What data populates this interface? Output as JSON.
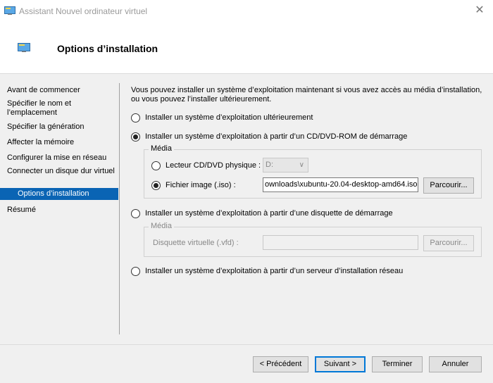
{
  "window": {
    "title": "Assistant Nouvel ordinateur virtuel",
    "close_glyph": "✕",
    "icon": "monitor-icon"
  },
  "header": {
    "title": "Options d’installation",
    "icon": "monitor-icon"
  },
  "sidebar": {
    "items": [
      {
        "label": "Avant de commencer"
      },
      {
        "label": "Spécifier le nom et l’emplacement"
      },
      {
        "label": "Spécifier la génération"
      },
      {
        "label": "Affecter la mémoire"
      },
      {
        "label": "Configurer la mise en réseau"
      },
      {
        "label": "Connecter un disque dur virtuel"
      },
      {
        "label": "Options d’installation"
      },
      {
        "label": "Résumé"
      }
    ],
    "active_index": 6
  },
  "content": {
    "intro": "Vous pouvez installer un système d’exploitation maintenant si vous avez accès au média d’installation, ou vous pouvez l’installer ultérieurement.",
    "options": [
      {
        "label": "Installer un système d’exploitation ultérieurement",
        "checked": false
      },
      {
        "label": "Installer un système d’exploitation à partir d’un CD/DVD-ROM de démarrage",
        "checked": true
      },
      {
        "label": "Installer un système d’exploitation à partir d’une disquette de démarrage",
        "checked": false
      },
      {
        "label": "Installer un système d’exploitation à partir d’un serveur d’installation réseau",
        "checked": false
      }
    ],
    "cd_media": {
      "legend": "Média",
      "physical_label": "Lecteur CD/DVD physique :",
      "physical_value": "D:",
      "physical_checked": false,
      "image_label": "Fichier image (.iso) :",
      "image_value": "ownloads\\xubuntu-20.04-desktop-amd64.iso",
      "image_checked": true,
      "browse_label": "Parcourir..."
    },
    "floppy_media": {
      "legend": "Média",
      "vfd_label": "Disquette virtuelle (.vfd) :",
      "vfd_value": "",
      "browse_label": "Parcourir..."
    }
  },
  "footer": {
    "prev_label": "< Précédent",
    "next_label": "Suivant >",
    "finish_label": "Terminer",
    "cancel_label": "Annuler"
  }
}
